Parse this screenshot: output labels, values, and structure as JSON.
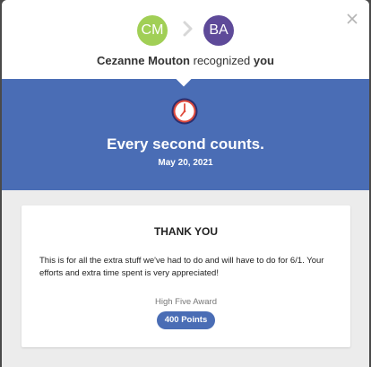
{
  "header": {
    "from_initials": "CM",
    "to_initials": "BA",
    "from_color": "#a1cf56",
    "to_color": "#5e4a99",
    "sender_name": "Cezanne Mouton",
    "verb": "recognized",
    "recipient": "you"
  },
  "banner": {
    "icon": "clock-icon",
    "title": "Every second counts.",
    "date": "May 20, 2021",
    "color": "#4a6db5"
  },
  "card": {
    "title": "THANK YOU",
    "message": "This is for all the extra stuff we've had to do and will have to do for 6/1. Your efforts and extra time spent is very appreciated!",
    "award_name": "High Five Award",
    "points": "400 Points"
  }
}
